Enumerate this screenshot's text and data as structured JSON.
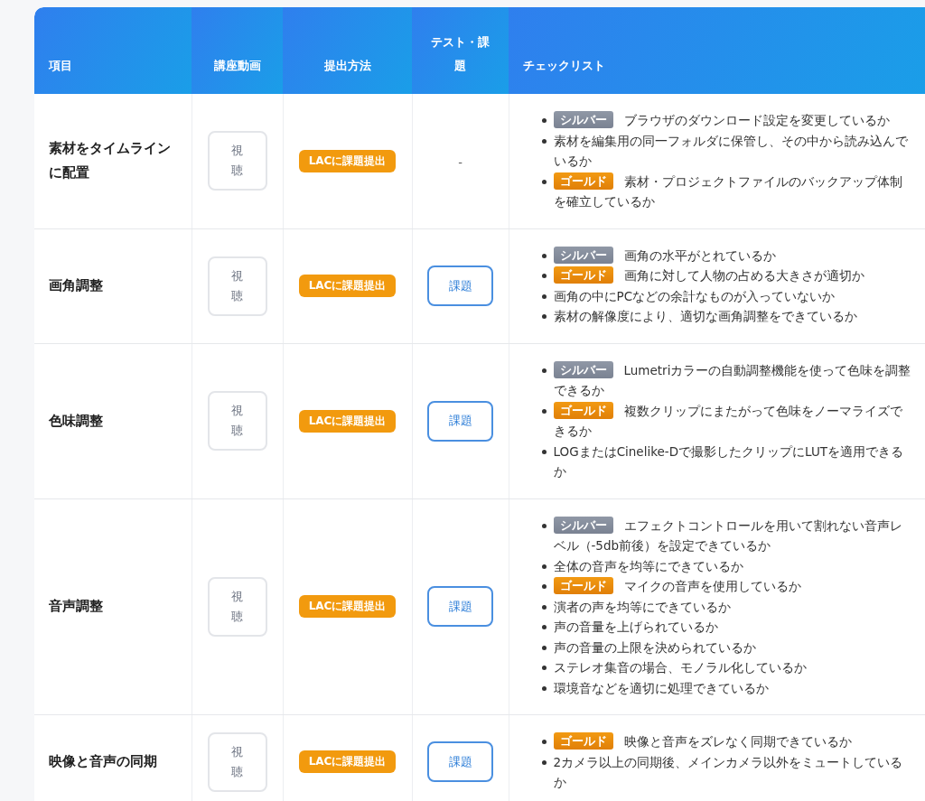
{
  "columns": [
    "項目",
    "講座動画",
    "提出方法",
    "テスト・課題",
    "チェックリスト"
  ],
  "rows": [
    {
      "item": "素材をタイムラインに配置",
      "video": "視聴",
      "submission": "LACに課題提出",
      "test": {
        "kind": "none",
        "label": "-"
      },
      "checklist": [
        {
          "kind": "silver",
          "badge": "シルバー",
          "text": "ブラウザのダウンロード設定を変更しているか"
        },
        {
          "kind": "plain",
          "text": "素材を編集用の同一フォルダに保管し、その中から読み込んでいるか"
        },
        {
          "kind": "gold",
          "badge": "ゴールド",
          "text": "素材・プロジェクトファイルのバックアップ体制を確立しているか"
        }
      ]
    },
    {
      "item": "画角調整",
      "video": "視聴",
      "submission": "LACに課題提出",
      "test": {
        "kind": "button",
        "label": "課題"
      },
      "checklist": [
        {
          "kind": "silver",
          "badge": "シルバー",
          "text": "画角の水平がとれているか"
        },
        {
          "kind": "gold",
          "badge": "ゴールド",
          "text": "画角に対して人物の占める大きさが適切か"
        },
        {
          "kind": "plain",
          "text": "画角の中にPCなどの余計なものが入っていないか"
        },
        {
          "kind": "plain",
          "text": "素材の解像度により、適切な画角調整をできているか"
        }
      ]
    },
    {
      "item": "色味調整",
      "video": "視聴",
      "submission": "LACに課題提出",
      "test": {
        "kind": "button",
        "label": "課題"
      },
      "checklist": [
        {
          "kind": "silver",
          "badge": "シルバー",
          "text": "Lumetriカラーの自動調整機能を使って色味を調整できるか"
        },
        {
          "kind": "gold",
          "badge": "ゴールド",
          "text": "複数クリップにまたがって色味をノーマライズできるか"
        },
        {
          "kind": "plain",
          "text": "LOGまたはCinelike-Dで撮影したクリップにLUTを適用できるか"
        }
      ]
    },
    {
      "item": "音声調整",
      "video": "視聴",
      "submission": "LACに課題提出",
      "test": {
        "kind": "button",
        "label": "課題"
      },
      "checklist": [
        {
          "kind": "silver",
          "badge": "シルバー",
          "text": "エフェクトコントロールを用いて割れない音声レベル（-5db前後）を設定できているか"
        },
        {
          "kind": "plain",
          "text": "全体の音声を均等にできているか"
        },
        {
          "kind": "gold",
          "badge": "ゴールド",
          "text": "マイクの音声を使用しているか"
        },
        {
          "kind": "plain",
          "text": "演者の声を均等にできているか"
        },
        {
          "kind": "plain",
          "text": "声の音量を上げられているか"
        },
        {
          "kind": "plain",
          "text": "声の音量の上限を決められているか"
        },
        {
          "kind": "plain",
          "text": "ステレオ集音の場合、モノラル化しているか"
        },
        {
          "kind": "plain",
          "text": "環境音などを適切に処理できているか"
        }
      ]
    },
    {
      "item": "映像と音声の同期",
      "video": "視聴",
      "submission": "LACに課題提出",
      "test": {
        "kind": "button",
        "label": "課題"
      },
      "checklist": [
        {
          "kind": "gold",
          "badge": "ゴールド",
          "text": "映像と音声をズレなく同期できているか"
        },
        {
          "kind": "plain",
          "text": "2カメラ以上の同期後、メインカメラ以外をミュートしているか"
        }
      ]
    }
  ]
}
